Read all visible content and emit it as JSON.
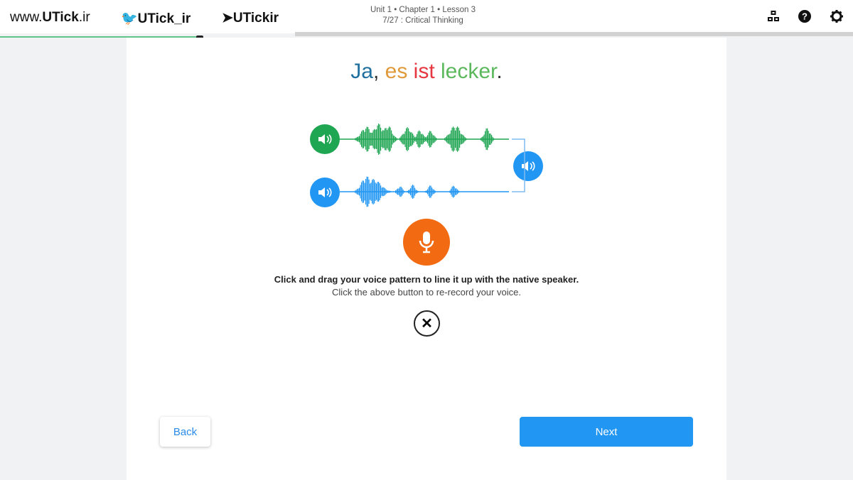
{
  "header": {
    "site_prefix": "www.",
    "site_name": "UTick",
    "site_suffix": ".ir",
    "twitter": "UTick_ir",
    "telegram": "UTickir",
    "breadcrumb": "Unit 1  •  Chapter 1  •  Lesson 3",
    "step": "7/27 : Critical Thinking",
    "icons": [
      "sitemap-icon",
      "help-icon",
      "gear-icon"
    ]
  },
  "progress": {
    "value_fraction": 0.23
  },
  "phrase": {
    "words": [
      {
        "text": "Ja",
        "color": "#1f6f9f"
      },
      {
        "text": ",",
        "color": "#333333"
      },
      {
        "text": " es",
        "color": "#e09a3a"
      },
      {
        "text": " ist",
        "color": "#e6363f"
      },
      {
        "text": " lecker",
        "color": "#5cb85c"
      },
      {
        "text": ".",
        "color": "#333333"
      }
    ]
  },
  "instructions": {
    "primary": "Click and drag your voice pattern to line it up with the native speaker.",
    "secondary": "Click the above button to re-record your voice."
  },
  "buttons": {
    "back": "Back",
    "next": "Next",
    "close": "✕"
  },
  "colors": {
    "native": "#1fa653",
    "user": "#2196f3",
    "mic": "#f26a12",
    "accent": "#2196f3"
  }
}
